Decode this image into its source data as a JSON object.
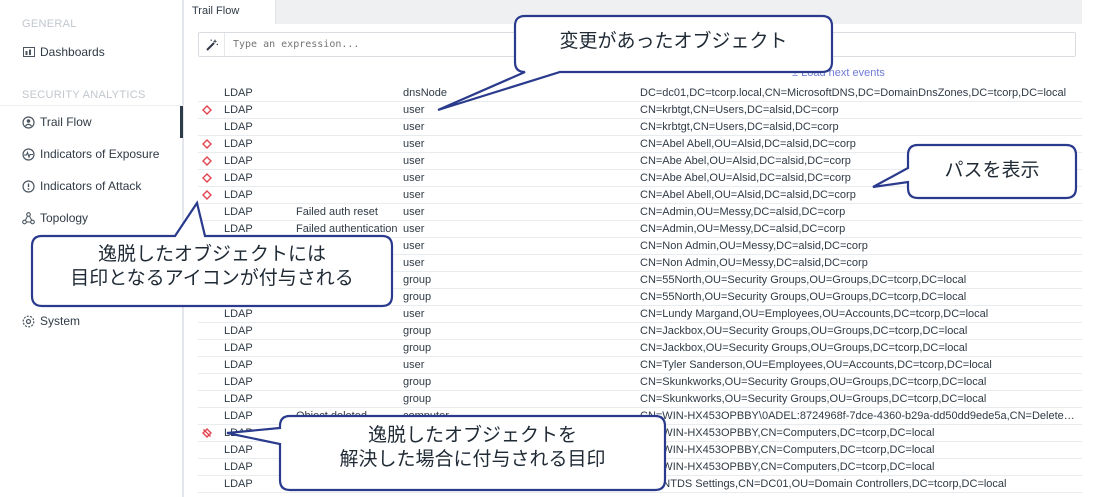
{
  "sidebar": {
    "general_label": "GENERAL",
    "security_label": "SECURITY ANALYTICS",
    "items": [
      {
        "label": "Dashboards"
      },
      {
        "label": "Trail Flow"
      },
      {
        "label": "Indicators of Exposure"
      },
      {
        "label": "Indicators of Attack"
      },
      {
        "label": "Topology"
      },
      {
        "label": "System"
      }
    ]
  },
  "tab": {
    "label": "Trail Flow"
  },
  "query": {
    "placeholder": "Type an expression..."
  },
  "load_next": "± Load next events",
  "rows": [
    {
      "icon": "none",
      "protocol": "LDAP",
      "result": "",
      "class": "dnsNode",
      "dn": "DC=dc01,DC=tcorp.local,CN=MicrosoftDNS,DC=DomainDnsZones,DC=tcorp,DC=local"
    },
    {
      "icon": "deviance",
      "protocol": "LDAP",
      "result": "",
      "class": "user",
      "dn": "CN=krbtgt,CN=Users,DC=alsid,DC=corp"
    },
    {
      "icon": "none",
      "protocol": "LDAP",
      "result": "",
      "class": "user",
      "dn": "CN=krbtgt,CN=Users,DC=alsid,DC=corp"
    },
    {
      "icon": "deviance",
      "protocol": "LDAP",
      "result": "",
      "class": "user",
      "dn": "CN=Abel Abell,OU=Alsid,DC=alsid,DC=corp"
    },
    {
      "icon": "deviance",
      "protocol": "LDAP",
      "result": "",
      "class": "user",
      "dn": "CN=Abe Abel,OU=Alsid,DC=alsid,DC=corp"
    },
    {
      "icon": "deviance",
      "protocol": "LDAP",
      "result": "",
      "class": "user",
      "dn": "CN=Abe Abel,OU=Alsid,DC=alsid,DC=corp"
    },
    {
      "icon": "deviance",
      "protocol": "LDAP",
      "result": "",
      "class": "user",
      "dn": "CN=Abel Abell,OU=Alsid,DC=alsid,DC=corp"
    },
    {
      "icon": "none",
      "protocol": "LDAP",
      "result": "Failed auth reset",
      "class": "user",
      "dn": "CN=Admin,OU=Messy,DC=alsid,DC=corp"
    },
    {
      "icon": "none",
      "protocol": "LDAP",
      "result": "Failed authentication",
      "class": "user",
      "dn": "CN=Admin,OU=Messy,DC=alsid,DC=corp"
    },
    {
      "icon": "none",
      "protocol": "LDAP",
      "result": "",
      "class": "user",
      "dn": "CN=Non Admin,OU=Messy,DC=alsid,DC=corp"
    },
    {
      "icon": "none",
      "protocol": "LDAP",
      "result": "",
      "class": "user",
      "dn": "CN=Non Admin,OU=Messy,DC=alsid,DC=corp"
    },
    {
      "icon": "none",
      "protocol": "LDAP",
      "result": "",
      "class": "group",
      "dn": "CN=55North,OU=Security Groups,OU=Groups,DC=tcorp,DC=local"
    },
    {
      "icon": "none",
      "protocol": "LDAP",
      "result": "",
      "class": "group",
      "dn": "CN=55North,OU=Security Groups,OU=Groups,DC=tcorp,DC=local"
    },
    {
      "icon": "none",
      "protocol": "LDAP",
      "result": "",
      "class": "user",
      "dn": "CN=Lundy Margand,OU=Employees,OU=Accounts,DC=tcorp,DC=local"
    },
    {
      "icon": "none",
      "protocol": "LDAP",
      "result": "",
      "class": "group",
      "dn": "CN=Jackbox,OU=Security Groups,OU=Groups,DC=tcorp,DC=local"
    },
    {
      "icon": "none",
      "protocol": "LDAP",
      "result": "",
      "class": "group",
      "dn": "CN=Jackbox,OU=Security Groups,OU=Groups,DC=tcorp,DC=local"
    },
    {
      "icon": "none",
      "protocol": "LDAP",
      "result": "",
      "class": "user",
      "dn": "CN=Tyler Sanderson,OU=Employees,OU=Accounts,DC=tcorp,DC=local"
    },
    {
      "icon": "none",
      "protocol": "LDAP",
      "result": "",
      "class": "group",
      "dn": "CN=Skunkworks,OU=Security Groups,OU=Groups,DC=tcorp,DC=local"
    },
    {
      "icon": "none",
      "protocol": "LDAP",
      "result": "",
      "class": "group",
      "dn": "CN=Skunkworks,OU=Security Groups,OU=Groups,DC=tcorp,DC=local"
    },
    {
      "icon": "none",
      "protocol": "LDAP",
      "result": "Object deleted",
      "class": "computer",
      "dn": "CN=WIN-HX453OPBBY\\0ADEL:8724968f-7dce-4360-b29a-dd50dd9ede5a,CN=Deleted Obj..."
    },
    {
      "icon": "resolved",
      "protocol": "LDAP",
      "result": "",
      "class": "",
      "dn": "CN=WIN-HX453OPBBY,CN=Computers,DC=tcorp,DC=local"
    },
    {
      "icon": "none",
      "protocol": "LDAP",
      "result": "",
      "class": "",
      "dn": "CN=WIN-HX453OPBBY,CN=Computers,DC=tcorp,DC=local"
    },
    {
      "icon": "none",
      "protocol": "LDAP",
      "result": "",
      "class": "",
      "dn": "CN=WIN-HX453OPBBY,CN=Computers,DC=tcorp,DC=local"
    },
    {
      "icon": "none",
      "protocol": "LDAP",
      "result": "",
      "class": "",
      "dn": "CN=NTDS Settings,CN=DC01,OU=Domain Controllers,DC=tcorp,DC=local"
    }
  ],
  "callouts": {
    "changed": "変更があったオブジェクト",
    "path": "パスを表示",
    "deviance_line1": "逸脱したオブジェクトには",
    "deviance_line2": "目印となるアイコンが付与される",
    "resolved_line1": "逸脱したオブジェクトを",
    "resolved_line2": "解決した場合に付与される目印"
  },
  "colors": {
    "deviance": "#e2454e",
    "callout_border": "#2a3a8c",
    "link": "#6f7bd6"
  }
}
